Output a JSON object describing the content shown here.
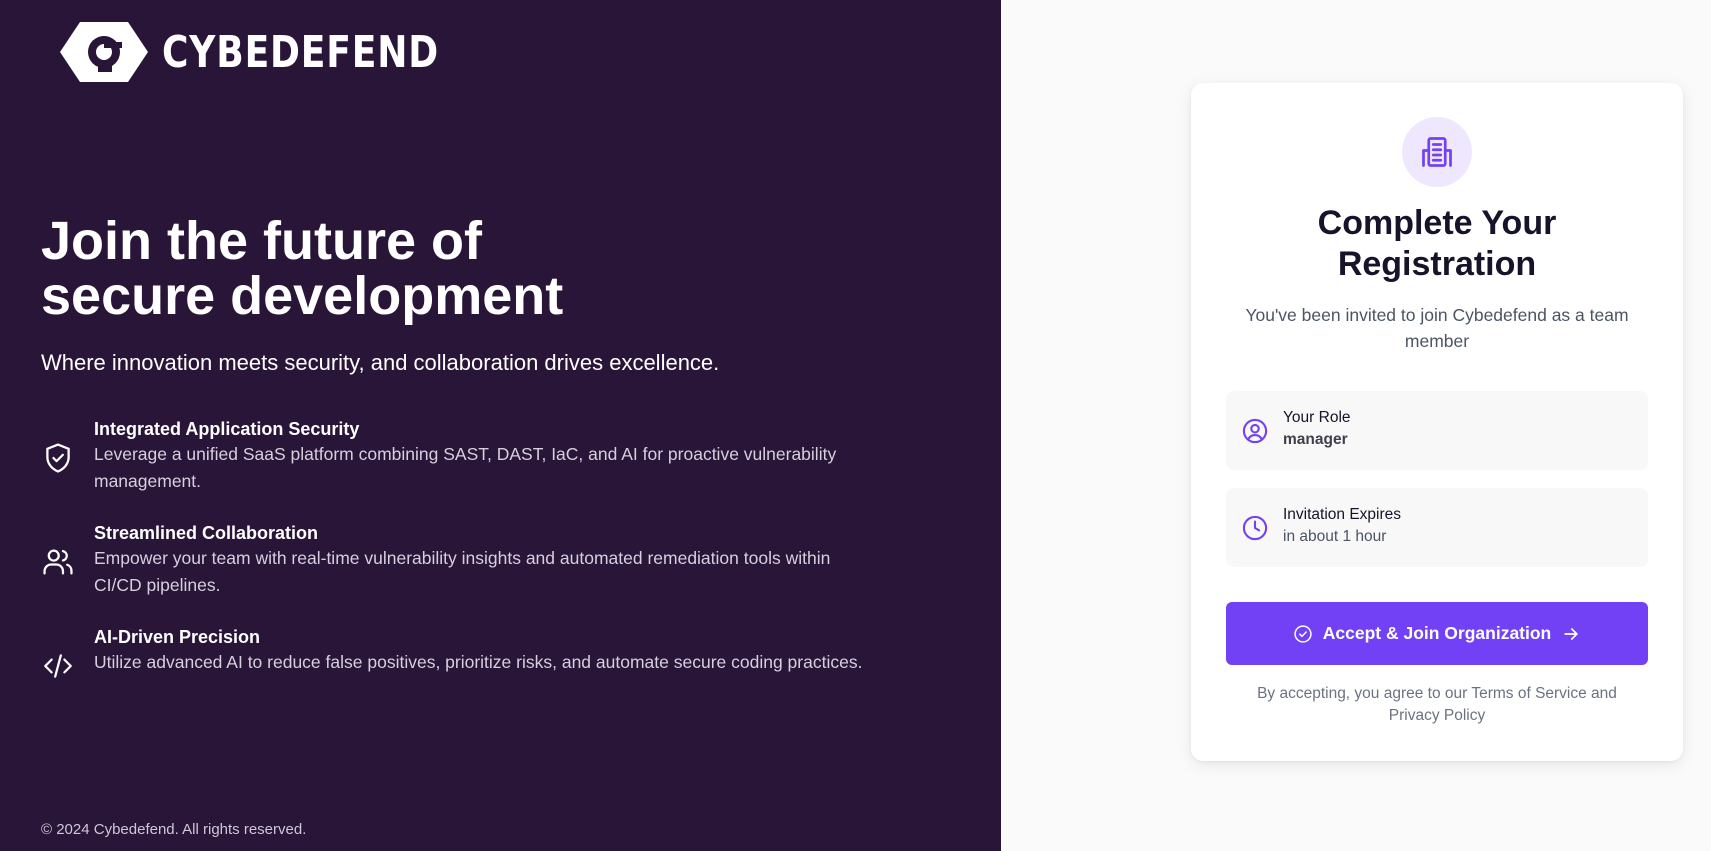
{
  "brand": {
    "name": "CYBEDEFEND"
  },
  "hero": {
    "headline_line1": "Join the future of",
    "headline_line2": "secure development",
    "subheading": "Where innovation meets security, and collaboration drives excellence."
  },
  "features": [
    {
      "icon": "shield-check-icon",
      "title": "Integrated Application Security",
      "description": "Leverage a unified SaaS platform combining SAST, DAST, IaC, and AI for proactive vulnerability management."
    },
    {
      "icon": "users-icon",
      "title": "Streamlined Collaboration",
      "description": "Empower your team with real-time vulnerability insights and automated remediation tools within CI/CD pipelines."
    },
    {
      "icon": "code-icon",
      "title": "AI-Driven Precision",
      "description": "Utilize advanced AI to reduce false positives, prioritize risks, and automate secure coding practices."
    }
  ],
  "footer": {
    "copyright": "© 2024 Cybedefend. All rights reserved."
  },
  "card": {
    "icon": "building-icon",
    "title_line1": "Complete Your",
    "title_line2": "Registration",
    "subtitle": "You've been invited to join Cybedefend as a team member",
    "role": {
      "icon": "user-circle-icon",
      "label": "Your Role",
      "value": "manager"
    },
    "expires": {
      "icon": "clock-icon",
      "label": "Invitation Expires",
      "value": "in about 1 hour"
    },
    "accept_button": {
      "label": "Accept & Join Organization",
      "left_icon": "check-circle-icon",
      "right_icon": "arrow-right-icon"
    },
    "terms": "By accepting, you agree to our Terms of Service and Privacy Policy"
  },
  "colors": {
    "left_background": "#281537",
    "accent": "#7241f5",
    "accent_light": "#efe7fe",
    "right_background": "#fafafa"
  }
}
